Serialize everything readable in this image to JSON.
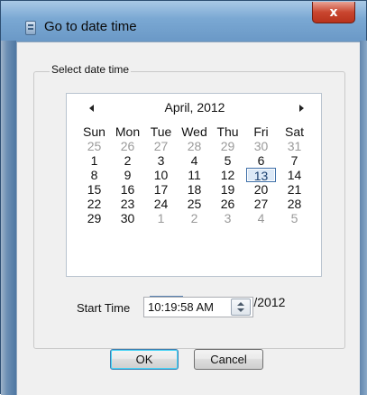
{
  "window": {
    "title": "Go to date time",
    "close_glyph": "x",
    "icon": "app-icon"
  },
  "group": {
    "label": "Select date time"
  },
  "calendar": {
    "month_title": "April, 2012",
    "prev_icon": "triangle-left-icon",
    "next_icon": "triangle-right-icon",
    "weekdays": [
      "Sun",
      "Mon",
      "Tue",
      "Wed",
      "Thu",
      "Fri",
      "Sat"
    ],
    "weeks": [
      [
        {
          "d": "25",
          "other": true
        },
        {
          "d": "26",
          "other": true
        },
        {
          "d": "27",
          "other": true
        },
        {
          "d": "28",
          "other": true
        },
        {
          "d": "29",
          "other": true
        },
        {
          "d": "30",
          "other": true
        },
        {
          "d": "31",
          "other": true
        }
      ],
      [
        {
          "d": "1"
        },
        {
          "d": "2"
        },
        {
          "d": "3"
        },
        {
          "d": "4"
        },
        {
          "d": "5"
        },
        {
          "d": "6"
        },
        {
          "d": "7"
        }
      ],
      [
        {
          "d": "8"
        },
        {
          "d": "9"
        },
        {
          "d": "10"
        },
        {
          "d": "11"
        },
        {
          "d": "12"
        },
        {
          "d": "13",
          "selected": true
        },
        {
          "d": "14"
        }
      ],
      [
        {
          "d": "15"
        },
        {
          "d": "16"
        },
        {
          "d": "17"
        },
        {
          "d": "18"
        },
        {
          "d": "19"
        },
        {
          "d": "20"
        },
        {
          "d": "21"
        }
      ],
      [
        {
          "d": "22"
        },
        {
          "d": "23"
        },
        {
          "d": "24"
        },
        {
          "d": "25"
        },
        {
          "d": "26"
        },
        {
          "d": "27"
        },
        {
          "d": "28"
        }
      ],
      [
        {
          "d": "29"
        },
        {
          "d": "30"
        },
        {
          "d": "1",
          "other": true
        },
        {
          "d": "2",
          "other": true
        },
        {
          "d": "3",
          "other": true
        },
        {
          "d": "4",
          "other": true
        },
        {
          "d": "5",
          "other": true
        }
      ]
    ],
    "today_text": "Today: 4/13/2012"
  },
  "start_time": {
    "label": "Start Time",
    "value": "10:19:58 AM"
  },
  "buttons": {
    "ok": "OK",
    "cancel": "Cancel"
  }
}
